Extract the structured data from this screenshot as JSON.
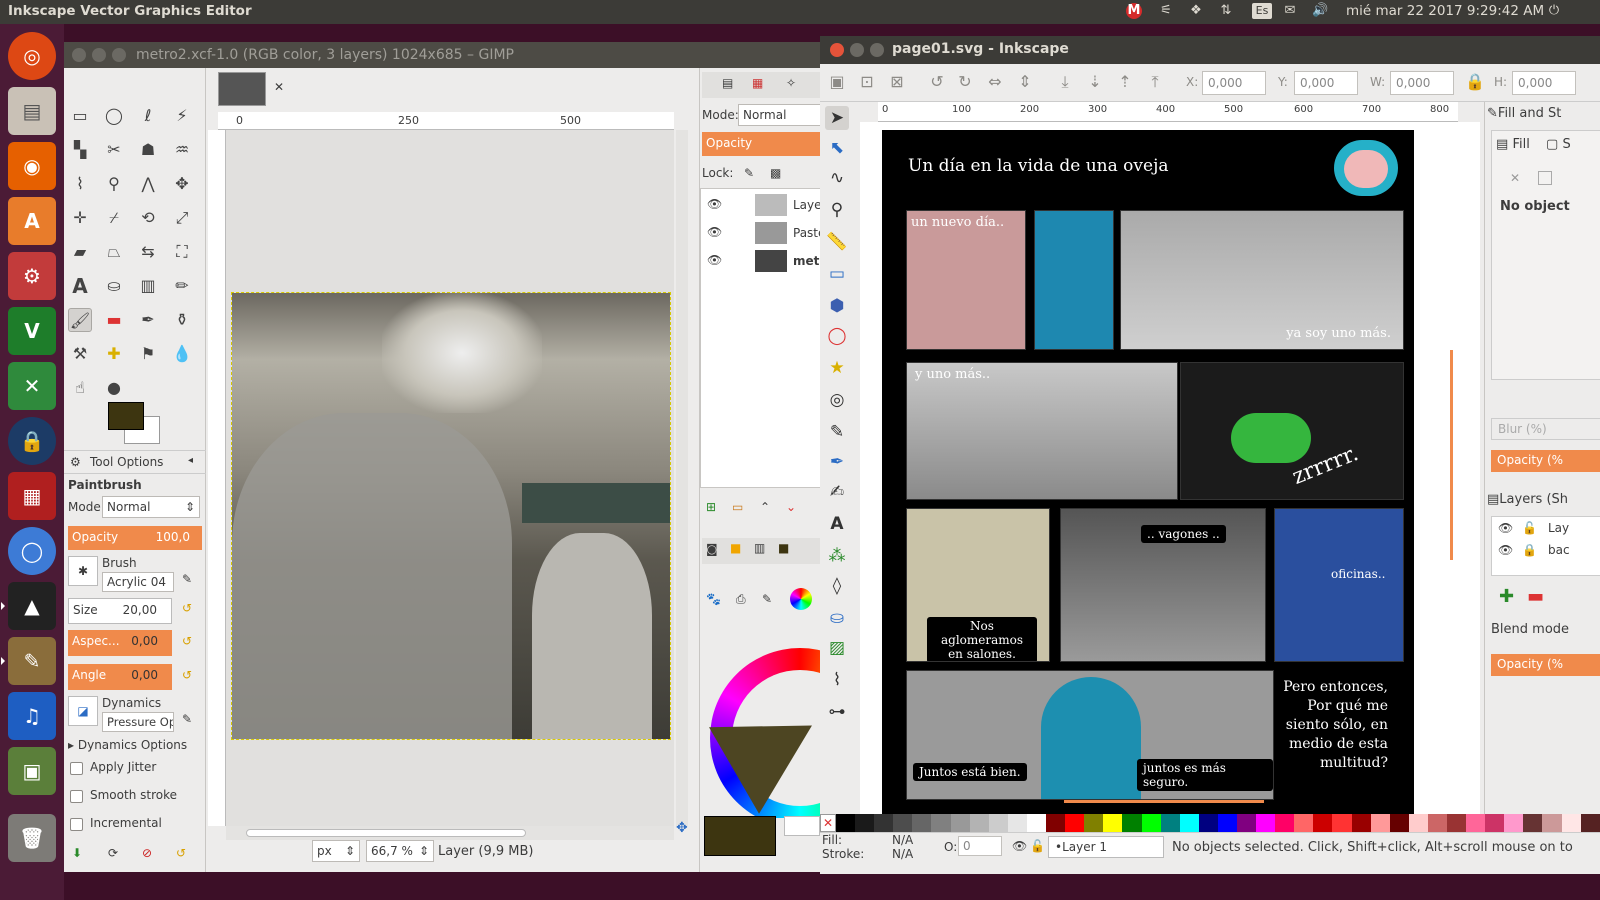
{
  "topbar": {
    "title": "Inkscape Vector Graphics Editor",
    "datetime": "mié mar 22 2017  9:29:42 AM",
    "keyboard": "Es"
  },
  "launcher": {
    "items": [
      "ubuntu",
      "files",
      "firefox",
      "software-center",
      "system-settings",
      "vim",
      "xmind",
      "keepass",
      "rdesktop",
      "chromium",
      "inkscape",
      "gimp",
      "audacity",
      "workspace",
      "trash"
    ]
  },
  "gimp": {
    "title": "metro2.xcf-1.0 (RGB color, 3 layers) 1024x685 – GIMP",
    "tool_options": {
      "header": "Tool Options",
      "tool_name": "Paintbrush",
      "mode_label": "Mode:",
      "mode_value": "Normal",
      "opacity_label": "Opacity",
      "opacity_value": "100,0",
      "brush_label": "Brush",
      "brush_value": "Acrylic 04",
      "size_label": "Size",
      "size_value": "20,00",
      "aspect_label": "Aspec...",
      "aspect_value": "0,00",
      "angle_label": "Angle",
      "angle_value": "0,00",
      "dynamics_label": "Dynamics",
      "dynamics_value": "Pressure Op",
      "dynamics_options": "Dynamics Options",
      "apply_jitter": "Apply Jitter",
      "smooth_stroke": "Smooth stroke",
      "incremental": "Incremental"
    },
    "ruler_ticks": [
      "0",
      "250",
      "500"
    ],
    "status": {
      "unit": "px",
      "zoom": "66,7 %",
      "layer_info": "Layer (9,9 MB)"
    },
    "layers": {
      "mode_label": "Mode:",
      "mode_value": "Normal",
      "opacity_label": "Opacity",
      "lock_label": "Lock:",
      "items": [
        "Layer",
        "Paste",
        "metr"
      ]
    },
    "colors": {
      "foreground": "#3d3510",
      "background": "#ffffff"
    }
  },
  "inkscape": {
    "title": "page01.svg - Inkscape",
    "coords": {
      "x_label": "X:",
      "x_value": "0,000",
      "y_label": "Y:",
      "y_value": "0,000",
      "w_label": "W:",
      "w_value": "0,000",
      "h_label": "H:",
      "h_value": "0,000"
    },
    "ruler_ticks": [
      "0",
      "100",
      "200",
      "300",
      "400",
      "500",
      "600",
      "700",
      "800"
    ],
    "comic": {
      "title": "Un día en la vida de una oveja",
      "texts": [
        "un nuevo día..",
        "ya soy uno más.",
        "y uno más..",
        "zrrrrr.",
        "Nos aglomeramos en salones.",
        ".. vagones ..",
        "oficinas..",
        "Juntos está bien.",
        "juntos es más seguro.",
        "Pero entonces, Por qué me siento sólo, en medio de esta multitud?"
      ]
    },
    "fill_panel": {
      "title": "Fill and St",
      "fill_tab": "Fill",
      "stroke_tab": "S",
      "no_object": "No object",
      "blur_label": "Blur (%)",
      "opacity_label": "Opacity (%",
      "layers_title": "Layers (Sh",
      "layer_col": "Lay",
      "layer_item": "bac",
      "blend_mode": "Blend mode",
      "opacity2": "Opacity (%"
    },
    "status": {
      "fill_label": "Fill:",
      "fill_value": "N/A",
      "stroke_label": "Stroke:",
      "stroke_value": "N/A",
      "o_label": "O:",
      "o_value": "0",
      "layer": "•Layer 1",
      "message": "No objects selected. Click, Shift+click, Alt+scroll mouse on to"
    },
    "palette": [
      "#000000",
      "#1a1a1a",
      "#333333",
      "#4d4d4d",
      "#666666",
      "#808080",
      "#999999",
      "#b3b3b3",
      "#cccccc",
      "#e6e6e6",
      "#ffffff",
      "#800000",
      "#ff0000",
      "#808000",
      "#ffff00",
      "#008000",
      "#00ff00",
      "#008080",
      "#00ffff",
      "#000080",
      "#0000ff",
      "#800080",
      "#ff00ff",
      "#ff0066",
      "#ff6666",
      "#cc0000",
      "#ff3333",
      "#990000",
      "#ff9999",
      "#660000",
      "#ffcccc",
      "#cc6666",
      "#993333",
      "#ff6699",
      "#cc3366",
      "#ff99cc",
      "#663333",
      "#cc9999",
      "#ffe6e6",
      "#552222"
    ]
  }
}
